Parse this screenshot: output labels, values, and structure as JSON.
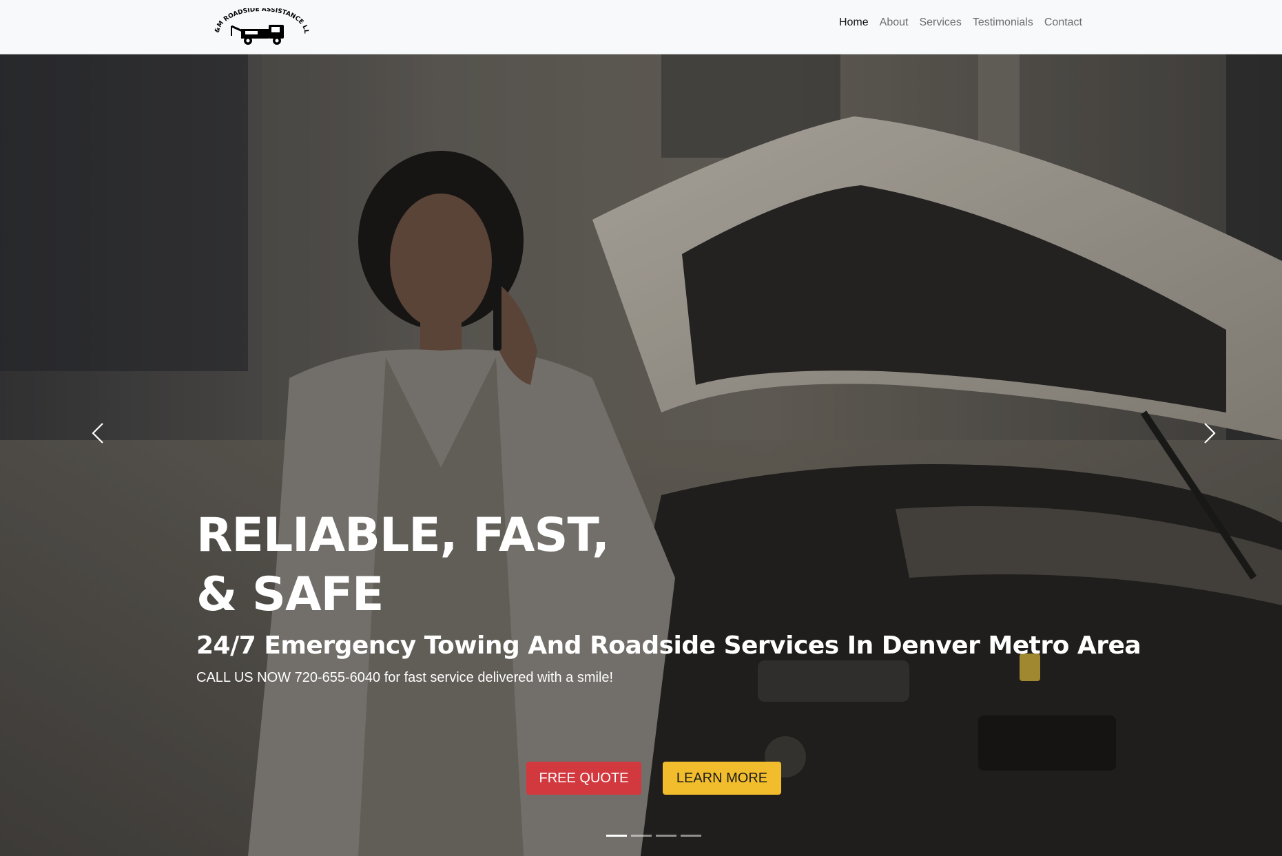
{
  "brand": {
    "name": "H&M Roadside Assistance LLC",
    "logo_text": "H&M ROADSIDE ASSISTANCE LLC",
    "logo_icon": "tow-truck-icon"
  },
  "nav": {
    "items": [
      {
        "label": "Home",
        "active": true
      },
      {
        "label": "About",
        "active": false
      },
      {
        "label": "Services",
        "active": false
      },
      {
        "label": "Testimonials",
        "active": false
      },
      {
        "label": "Contact",
        "active": false
      }
    ]
  },
  "hero": {
    "headline_line1": "RELIABLE, FAST,",
    "headline_line2": "& SAFE",
    "subheadline": "24/7 Emergency Towing And Roadside Services In Denver Metro Area",
    "tagline": "CALL US NOW 720-655-6040 for fast service delivered with a smile!",
    "buttons": {
      "quote_label": "FREE QUOTE",
      "learn_label": "LEARN MORE"
    },
    "prev_icon": "chevron-left-icon",
    "next_icon": "chevron-right-icon",
    "slides_total": 4,
    "active_slide": 1
  },
  "colors": {
    "nav_bg": "#f8f9fa",
    "nav_active": "#111111",
    "nav_text": "#6c6c6c",
    "btn_quote": "#d2393f",
    "btn_learn": "#f2bd2c",
    "hero_text": "#ffffff"
  }
}
